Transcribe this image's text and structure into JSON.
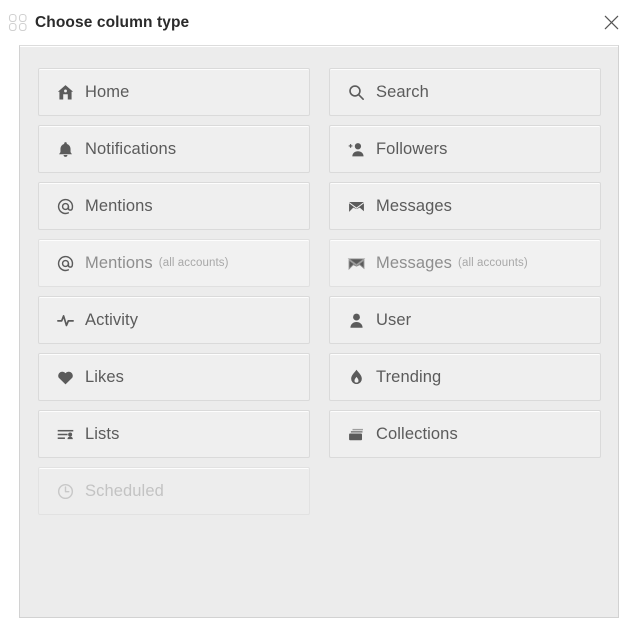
{
  "window": {
    "title": "Choose column type",
    "title_icon": "columns-grid-icon",
    "close_icon": "close-icon",
    "close_label": "×"
  },
  "colors": {
    "page_background": "#ffffff",
    "panel_background": "#ececec",
    "panel_border": "#d2d2d2",
    "button_background": "#efefef",
    "button_border": "#dadada",
    "label_text": "#5b5b5b",
    "sublabel_text": "#9b9b9b",
    "title_text": "#2b2b2b",
    "disabled_text": "#c3c3c3"
  },
  "options": [
    {
      "id": "home",
      "label": "Home",
      "sublabel": "",
      "icon": "home-icon",
      "state": "normal"
    },
    {
      "id": "search",
      "label": "Search",
      "sublabel": "",
      "icon": "search-icon",
      "state": "normal"
    },
    {
      "id": "notifications",
      "label": "Notifications",
      "sublabel": "",
      "icon": "bell-icon",
      "state": "normal"
    },
    {
      "id": "followers",
      "label": "Followers",
      "sublabel": "",
      "icon": "user-plus-icon",
      "state": "normal"
    },
    {
      "id": "mentions",
      "label": "Mentions",
      "sublabel": "",
      "icon": "at-icon",
      "state": "normal"
    },
    {
      "id": "messages",
      "label": "Messages",
      "sublabel": "",
      "icon": "envelope-icon",
      "state": "normal"
    },
    {
      "id": "mentions-all",
      "label": "Mentions",
      "sublabel": "(all accounts)",
      "icon": "at-icon",
      "state": "muted"
    },
    {
      "id": "messages-all",
      "label": "Messages",
      "sublabel": "(all accounts)",
      "icon": "envelope-icon",
      "state": "muted"
    },
    {
      "id": "activity",
      "label": "Activity",
      "sublabel": "",
      "icon": "pulse-icon",
      "state": "normal"
    },
    {
      "id": "user",
      "label": "User",
      "sublabel": "",
      "icon": "user-icon",
      "state": "normal"
    },
    {
      "id": "likes",
      "label": "Likes",
      "sublabel": "",
      "icon": "heart-icon",
      "state": "normal"
    },
    {
      "id": "trending",
      "label": "Trending",
      "sublabel": "",
      "icon": "flame-icon",
      "state": "normal"
    },
    {
      "id": "lists",
      "label": "Lists",
      "sublabel": "",
      "icon": "list-icon",
      "state": "normal"
    },
    {
      "id": "collections",
      "label": "Collections",
      "sublabel": "",
      "icon": "collections-icon",
      "state": "normal"
    },
    {
      "id": "scheduled",
      "label": "Scheduled",
      "sublabel": "",
      "icon": "clock-icon",
      "state": "disabled"
    }
  ]
}
